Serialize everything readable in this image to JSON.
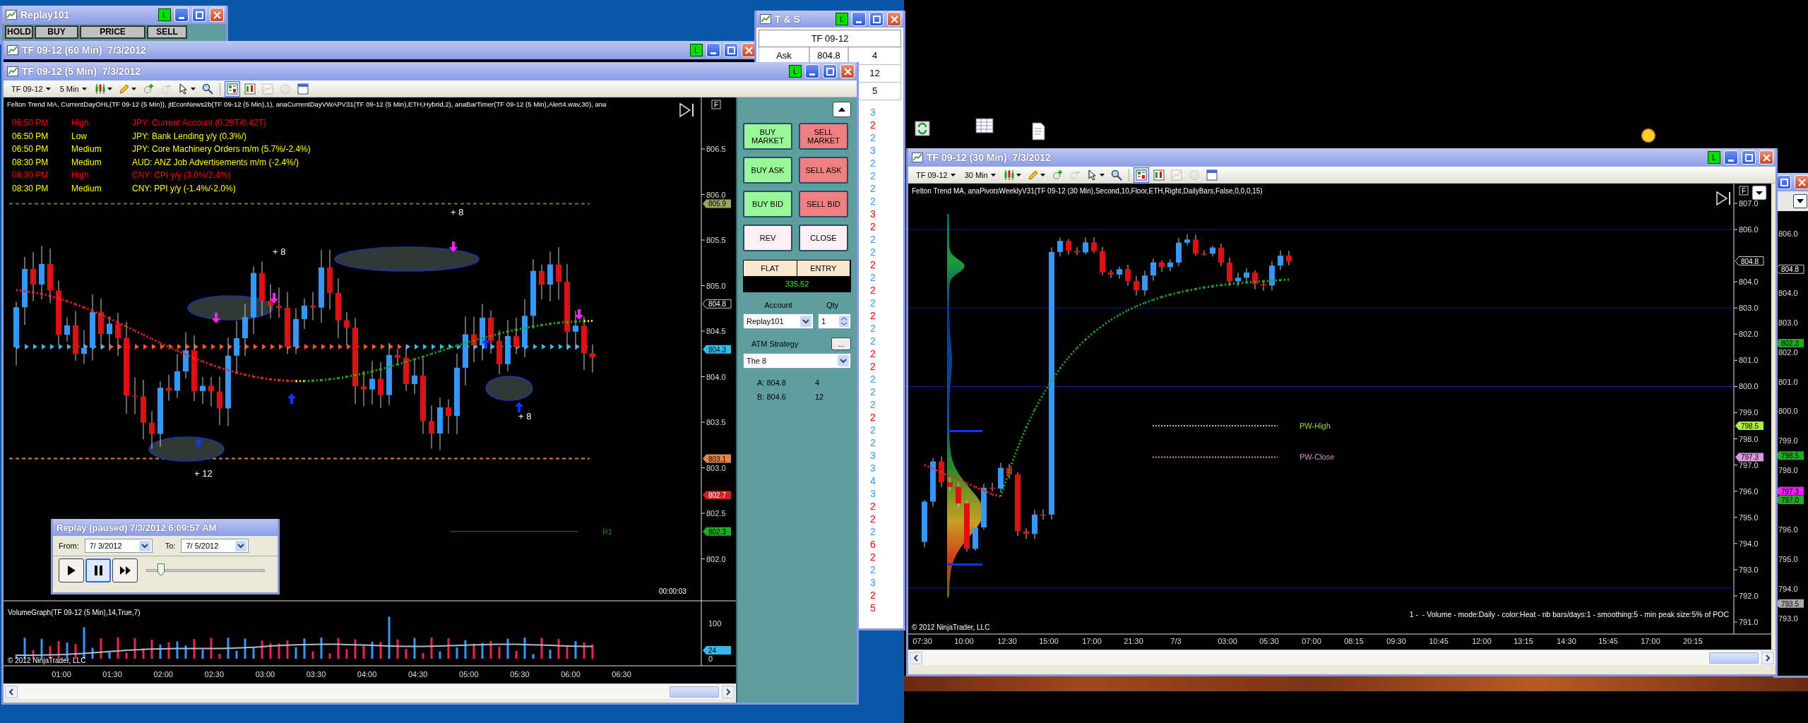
{
  "replay101": {
    "title": "Replay101",
    "badge": "L",
    "columns": [
      "HOLD",
      "BUY",
      "PRICE",
      "SELL"
    ]
  },
  "chart_60min": {
    "title": "TF 09-12 (60 Min)  7/3/2012",
    "badge": "L"
  },
  "time_and_sales": {
    "title": "T & S",
    "badge": "L",
    "instrument": "TF 09-12",
    "quotes": [
      {
        "label": "Ask",
        "price": "804.8",
        "size": "4"
      },
      {
        "size": "12"
      },
      {
        "size": "5"
      }
    ],
    "trades": [
      {
        "size": "3",
        "color": "#3399ff"
      },
      {
        "size": "2",
        "color": "#ff0000"
      },
      {
        "size": "2",
        "color": "#3399ff"
      },
      {
        "size": "3",
        "color": "#3399ff"
      },
      {
        "size": "2",
        "color": "#3399ff"
      },
      {
        "size": "2",
        "color": "#3399ff"
      },
      {
        "size": "2",
        "color": "#3399ff"
      },
      {
        "size": "2",
        "color": "#3399ff"
      },
      {
        "size": "3",
        "color": "#ff0000"
      },
      {
        "size": "2",
        "color": "#ff0000"
      },
      {
        "size": "2",
        "color": "#3399ff"
      },
      {
        "size": "2",
        "color": "#3399ff"
      },
      {
        "size": "2",
        "color": "#ff0000"
      },
      {
        "size": "2",
        "color": "#3399ff"
      },
      {
        "size": "2",
        "color": "#ff0000"
      },
      {
        "size": "2",
        "color": "#3399ff"
      },
      {
        "size": "2",
        "color": "#ff0000"
      },
      {
        "size": "2",
        "color": "#3399ff"
      },
      {
        "size": "2",
        "color": "#3399ff"
      },
      {
        "size": "2",
        "color": "#ff0000"
      },
      {
        "size": "2",
        "color": "#ff0000"
      },
      {
        "size": "2",
        "color": "#3399ff"
      },
      {
        "size": "2",
        "color": "#3399ff"
      },
      {
        "size": "2",
        "color": "#3399ff"
      },
      {
        "size": "2",
        "color": "#ff0000"
      },
      {
        "size": "2",
        "color": "#3399ff"
      },
      {
        "size": "2",
        "color": "#3399ff"
      },
      {
        "size": "3",
        "color": "#3399ff"
      },
      {
        "size": "3",
        "color": "#3399ff"
      },
      {
        "size": "4",
        "color": "#3399ff"
      },
      {
        "size": "3",
        "color": "#3399ff"
      },
      {
        "size": "2",
        "color": "#ff0000"
      },
      {
        "size": "2",
        "color": "#ff0000"
      },
      {
        "size": "2",
        "color": "#3399ff"
      },
      {
        "size": "6",
        "color": "#ff0000"
      },
      {
        "size": "2",
        "color": "#ff0000"
      },
      {
        "size": "2",
        "color": "#3399ff"
      },
      {
        "size": "3",
        "color": "#3399ff"
      },
      {
        "size": "2",
        "color": "#ff0000"
      },
      {
        "size": "5",
        "color": "#ff0000"
      }
    ]
  },
  "chart_5min": {
    "title": "TF 09-12 (5 Min)  7/3/2012",
    "badge": "L",
    "toolbar": {
      "instrument": "TF 09-12",
      "interval": "5 Min",
      "tools": [
        {
          "kind": "candles",
          "selected": false,
          "disabled": false
        },
        {
          "kind": "pencil",
          "selected": false,
          "disabled": false
        },
        {
          "kind": "zoom_in",
          "selected": false,
          "disabled": false
        },
        {
          "kind": "zoom_out",
          "selected": false,
          "disabled": true
        },
        {
          "kind": "pointer",
          "selected": false,
          "disabled": false
        },
        {
          "kind": "search",
          "selected": false,
          "disabled": false
        },
        {
          "kind": "data_box",
          "selected": true,
          "disabled": false
        },
        {
          "kind": "chart_style",
          "selected": false,
          "disabled": false
        },
        {
          "kind": "line",
          "selected": false,
          "disabled": true
        },
        {
          "kind": "dollar",
          "selected": false,
          "disabled": true
        },
        {
          "kind": "properties",
          "selected": false,
          "disabled": false
        }
      ]
    },
    "indicators": "Felton Trend MA, CurrentDayOHL(TF 09-12 (5 Min)), jtEconNews2b(TF 09-12 (5 Min),1), anaCurrentDayVWAPV31(TF 09-12 (5 Min),ETH,Hybrid,2), anaBarTimer(TF 09-12 (5 Min),Alert4.wav,30), ana",
    "f_button": "F",
    "news": [
      {
        "time": "06:50 PM",
        "impact": "High",
        "event": "JPY: Current Account (0.29T/0.42T)",
        "color": "#ff0000"
      },
      {
        "time": "06:50 PM",
        "impact": "Low",
        "event": "JPY: Bank Lending y/y (0.3%/)",
        "color": "#ffff00"
      },
      {
        "time": "06:50 PM",
        "impact": "Medium",
        "event": "JPY: Core Machinery Orders m/m (5.7%/-2.4%)",
        "color": "#ffff00"
      },
      {
        "time": "08:30 PM",
        "impact": "Medium",
        "event": "AUD: ANZ Job Advertisements m/m (-2.4%/)",
        "color": "#ffff00"
      },
      {
        "time": "08:30 PM",
        "impact": "High",
        "event": "CNY: CPI y/y (3.0%/2.4%)",
        "color": "#ff0000"
      },
      {
        "time": "08:30 PM",
        "impact": "Medium",
        "event": "CNY: PPI y/y (-1.4%/-2.0%)",
        "color": "#ffff00"
      }
    ],
    "price_axis": [
      "806.5",
      "806.0",
      "805.5",
      "805.0",
      "804.5",
      "804.0",
      "803.5",
      "803.0",
      "802.5",
      "802.0"
    ],
    "price_markers": [
      {
        "label": "805.9",
        "color": "#9aa860"
      },
      {
        "label": "804.8",
        "color": "#000000"
      },
      {
        "label": "804.3",
        "color": "#33bbee"
      },
      {
        "label": "803.1",
        "color": "#e08848"
      },
      {
        "label": "802.7",
        "color": "#cc2222"
      },
      {
        "label": "802.3",
        "color": "#22aa22"
      }
    ],
    "annotations": [
      "+ 8",
      "+ 8",
      "+ 8",
      "+ 12"
    ],
    "pivot_label": "R1",
    "bar_timer": "00:00:03",
    "volume_title": "VolumeGraph(TF 09-12 (5 Min),14,True,7)",
    "volume_axis": [
      "100",
      "0"
    ],
    "volume_markers": [
      {
        "label": "24",
        "color": "#33bbee"
      }
    ],
    "copyright": "© 2012 NinjaTrader, LLC",
    "time_axis": [
      "01:00",
      "01:30",
      "02:00",
      "02:30",
      "03:00",
      "03:30",
      "04:00",
      "04:30",
      "05:00",
      "05:30",
      "06:00",
      "06:30"
    ]
  },
  "order_entry": {
    "buttons": [
      {
        "label": "BUY MARKET",
        "kind": "buy"
      },
      {
        "label": "SELL MARKET",
        "kind": "sell"
      },
      {
        "label": "BUY ASK",
        "kind": "buy"
      },
      {
        "label": "SELL ASK",
        "kind": "sell"
      },
      {
        "label": "BUY BID",
        "kind": "buy"
      },
      {
        "label": "SELL BID",
        "kind": "sell"
      },
      {
        "label": "REV",
        "kind": "neutral"
      },
      {
        "label": "CLOSE",
        "kind": "neutral"
      }
    ],
    "position": {
      "state": "FLAT",
      "entry_label": "ENTRY",
      "pnl": "335.52"
    },
    "account_label": "Account",
    "account": "Replay101",
    "qty_label": "Qty",
    "qty": "1",
    "atm_label": "ATM Strategy",
    "atm_more": "...",
    "atm_strategy": "The 8",
    "quotes": [
      {
        "label": "A: 804.8",
        "size": "4"
      },
      {
        "label": "B: 804.6",
        "size": "12"
      }
    ]
  },
  "replay_control": {
    "title": "Replay (paused) 7/3/2012 6:09:57 AM",
    "from_label": "From:",
    "from": "7/ 3/2012",
    "to_label": "To:",
    "to": "7/ 5/2012",
    "transport": [
      {
        "kind": "play",
        "selected": false
      },
      {
        "kind": "pause",
        "selected": true
      },
      {
        "kind": "fast_forward",
        "selected": false
      }
    ],
    "speed": {
      "level": 0.12
    }
  },
  "chart_30min": {
    "title": "TF 09-12 (30 Min)  7/3/2012",
    "badge": "L",
    "toolbar": {
      "instrument": "TF 09-12",
      "interval": "30 Min",
      "tools": [
        {
          "kind": "candles",
          "selected": false,
          "disabled": false
        },
        {
          "kind": "pencil",
          "selected": false,
          "disabled": false
        },
        {
          "kind": "zoom_in",
          "selected": false,
          "disabled": false
        },
        {
          "kind": "zoom_out",
          "selected": false,
          "disabled": true
        },
        {
          "kind": "pointer",
          "selected": false,
          "disabled": false
        },
        {
          "kind": "search",
          "selected": false,
          "disabled": false
        },
        {
          "kind": "data_box",
          "selected": true,
          "disabled": false
        },
        {
          "kind": "chart_style",
          "selected": false,
          "disabled": false
        },
        {
          "kind": "line",
          "selected": false,
          "disabled": true
        },
        {
          "kind": "dollar",
          "selected": false,
          "disabled": true
        },
        {
          "kind": "properties",
          "selected": false,
          "disabled": false
        }
      ]
    },
    "indicators": "Felton Trend MA, anaPivotsWeeklyV31(TF 09-12 (30 Min),Second,10,Floor,ETH,Right,DailyBars,False,0,0,0,15)",
    "f_button": "F",
    "price_axis": [
      "807.0",
      "806.0",
      "804.0",
      "803.0",
      "802.0",
      "801.0",
      "800.0",
      "799.0",
      "798.0",
      "797.0",
      "796.0",
      "795.0",
      "794.0",
      "793.0",
      "792.0",
      "791.0"
    ],
    "price_markers": [
      {
        "label": "804.8",
        "color": "#000000"
      },
      {
        "label": "798.5",
        "color": "#aaee44"
      },
      {
        "label": "797.3",
        "color": "#dd99dd"
      }
    ],
    "plot_labels": [
      {
        "text": "PW-High",
        "color": "#99dd33"
      },
      {
        "text": "PW-Close",
        "color": "#dd88dd"
      }
    ],
    "profile_info": "1 -  - Volume - mode:Daily - color:Heat - nb bars/days:1 - smoothing:5 - min peak size:5% of POC",
    "copyright": "© 2012 NinjaTrader, LLC",
    "time_axis": [
      "07:30",
      "10:00",
      "12:30",
      "15:00",
      "17:00",
      "21:30",
      "7/3",
      "03:00",
      "05:30",
      "07:00",
      "08:15",
      "09:30",
      "10:45",
      "12:00",
      "13:15",
      "14:30",
      "15:45",
      "17:00",
      "20:15"
    ]
  },
  "background_chart": {
    "price_axis": [
      "806.0",
      "804.0",
      "803.0",
      "802.0",
      "801.0",
      "800.0",
      "799.0",
      "798.0",
      "796.0",
      "795.0",
      "794.0",
      "793.0"
    ],
    "price_markers": [
      {
        "label": "804.8",
        "color": "#000000"
      },
      {
        "label": "802.3",
        "color": "#22aa22"
      },
      {
        "label": "798.5",
        "color": "#22aa22"
      },
      {
        "label": "797.3",
        "color": "#ee22ee"
      },
      {
        "label": "797.0",
        "color": "#22aa22"
      },
      {
        "label": "793.5",
        "color": "#aaaaaa"
      }
    ]
  }
}
